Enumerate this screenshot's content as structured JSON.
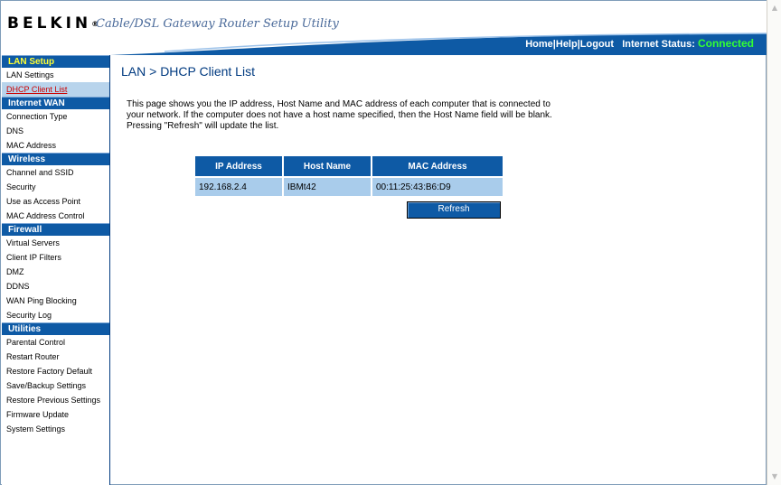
{
  "header": {
    "logo": "BELKIN",
    "logo_mark": "®",
    "tagline": "Cable/DSL Gateway Router Setup Utility",
    "nav": {
      "home": "Home",
      "sep1": "|",
      "help": "Help",
      "sep2": "|",
      "logout": "Logout"
    },
    "status_label": "Internet Status:",
    "status_value": "Connected"
  },
  "sidebar": {
    "sections": [
      {
        "title": "LAN Setup",
        "items": [
          "LAN Settings",
          "DHCP Client List"
        ]
      },
      {
        "title": "Internet WAN",
        "items": [
          "Connection Type",
          "DNS",
          "MAC Address"
        ]
      },
      {
        "title": "Wireless",
        "items": [
          "Channel and SSID",
          "Security",
          "Use as Access Point",
          "MAC Address Control"
        ]
      },
      {
        "title": "Firewall",
        "items": [
          "Virtual Servers",
          "Client IP Filters",
          "DMZ",
          "DDNS",
          "WAN Ping Blocking",
          "Security Log"
        ]
      },
      {
        "title": "Utilities",
        "items": [
          "Parental Control",
          "Restart Router",
          "Restore Factory Default",
          "Save/Backup Settings",
          "Restore Previous Settings",
          "Firmware Update",
          "System Settings"
        ]
      }
    ],
    "active_item": "DHCP Client List"
  },
  "main": {
    "title": "LAN > DHCP Client List",
    "description": "This page shows you the IP address, Host Name and MAC address of each computer that is connected to your network. If the computer does not have a host name specified, then the Host Name field will be blank. Pressing \"Refresh\" will update the list.",
    "table": {
      "headers": [
        "IP Address",
        "Host Name",
        "MAC Address"
      ],
      "rows": [
        [
          "192.168.2.4",
          "IBMt42",
          "00:11:25:43:B6:D9"
        ]
      ]
    },
    "refresh_label": "Refresh"
  },
  "colors": {
    "brand_blue": "#0e5aa5",
    "row_blue": "#a9cceb",
    "status_green": "#33ff33",
    "active_link": "#cc0000"
  }
}
